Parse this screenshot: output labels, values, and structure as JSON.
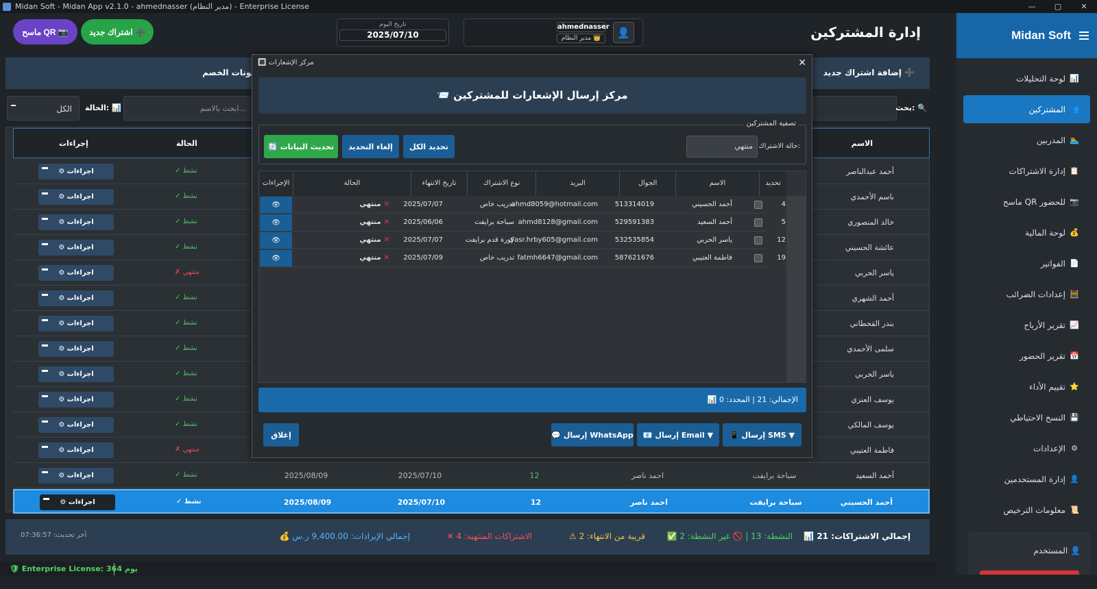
{
  "window": {
    "title": "Midan Soft - Midan App v2.1.0 - ahmednasser (مدير النظام) - Enterprise License",
    "minimize": "—",
    "maximize": "▢",
    "close": "✕"
  },
  "sidebar": {
    "brand": "Midan Soft",
    "items": [
      {
        "label": "لوحة التحليلات",
        "icon": "📊"
      },
      {
        "label": "المشتركين",
        "icon": "👥"
      },
      {
        "label": "المدربين",
        "icon": "🏊"
      },
      {
        "label": "إدارة الاشتراكات",
        "icon": "📋"
      },
      {
        "label": "ماسح QR للحضور",
        "icon": "📷"
      },
      {
        "label": "لوحة المالية",
        "icon": "💰"
      },
      {
        "label": "الفواتير",
        "icon": "📄"
      },
      {
        "label": "إعدادات الضرائب",
        "icon": "🧮"
      },
      {
        "label": "تقرير الأرباح",
        "icon": "📈"
      },
      {
        "label": "تقرير الحضور",
        "icon": "📅"
      },
      {
        "label": "تقييم الأداء",
        "icon": "⭐"
      },
      {
        "label": "النسخ الاحتياطي",
        "icon": "💾"
      },
      {
        "label": "الإعدادات",
        "icon": "⚙"
      },
      {
        "label": "إدارة المستخدمين",
        "icon": "👤"
      },
      {
        "label": "معلومات الترخيص",
        "icon": "📜"
      }
    ],
    "user_label": "المستخدم",
    "user_icon": "👤"
  },
  "header": {
    "title": "إدارة المشتركين",
    "qr_button": "ماسح QR 📷",
    "new_sub_button": "اشتراك جديد ➕",
    "date_label": "تاريخ اليوم",
    "date_value": "2025/07/10",
    "username": "ahmednasser",
    "role": "مدير النظام 👑",
    "avatar_icon": "👤"
  },
  "actionbar": {
    "add_new": "إضافة اشتراك جديد ➕",
    "coupons": "كوبونات الخصم"
  },
  "search": {
    "status_label": "الحالة:",
    "status_icon": "📊",
    "status_value": "الكل",
    "search_placeholder": "ابحث بالاسم...",
    "search_label": "بحث:",
    "search_icon": "🔍"
  },
  "bg_table": {
    "headers": {
      "name": "الاسم",
      "status": "الحالة",
      "actions": "إجراءات"
    },
    "action_label": "⚙ اجراءات",
    "rows": [
      {
        "name": "أحمد عبدالناصر",
        "status": "✓ نشط",
        "ok": true
      },
      {
        "name": "باسم الأحمدي",
        "status": "✓ نشط",
        "ok": true
      },
      {
        "name": "خالد المنصوري",
        "status": "✓ نشط",
        "ok": true
      },
      {
        "name": "عائشة الحسيني",
        "status": "✓ نشط",
        "ok": true
      },
      {
        "name": "ياسر الحربي",
        "status": "✗ منتهي",
        "ok": false
      },
      {
        "name": "أحمد الشهري",
        "status": "✓ نشط",
        "ok": true
      },
      {
        "name": "بندر القحطاني",
        "status": "✓ نشط",
        "ok": true
      },
      {
        "name": "سلمى الأحمدي",
        "status": "✓ نشط",
        "ok": true
      },
      {
        "name": "ياسر الحربي",
        "status": "✓ نشط",
        "ok": true
      },
      {
        "name": "يوسف العنزي",
        "status": "✓ نشط",
        "ok": true
      },
      {
        "name": "يوسف المالكي",
        "status": "✓ نشط",
        "ok": true
      },
      {
        "name": "فاطمة العتيبي",
        "status": "✗ منتهي",
        "ok": false
      },
      {
        "name": "أحمد السعيد",
        "status": "✓ نشط",
        "ok": true,
        "type": "سباحة برايفت",
        "coach": "احمد ناصر",
        "sessions": "12",
        "start": "2025/07/10",
        "end": "2025/08/09"
      },
      {
        "name": "أحمد الحسيني",
        "status": "✓ نشط",
        "ok": true,
        "type": "سباحة برايفت",
        "coach": "احمد ناصر",
        "sessions": "12",
        "start": "2025/07/10",
        "end": "2025/08/09",
        "selected": true
      }
    ]
  },
  "summary": {
    "total": "📊 إجمالي الاشتراكات: 21",
    "active": "✅ النشطة: 13 | 🚫 غير النشطة: 2",
    "near_end": "⚠ قريبة من الانتهاء: 2",
    "expired": "✕ الاشتراكات المنتهية: 4",
    "revenue": "💰 إجمالي الإيرادات: 9,400.00 ر.س",
    "updated": "آخر تحديث: 07:36:57"
  },
  "statusbar": {
    "license": "🛡 Enterprise License: 364 يوم"
  },
  "modal": {
    "title": "مركز الإشعارات",
    "title_icon": "🔳",
    "heading": "📨 مركز إرسال الإشعارات للمشتركين",
    "filter_legend": "تصفية المشتركين",
    "filter_label": "حالة الاشتراك:",
    "filter_value": "منتهي",
    "select_all": "تحديد الكل",
    "clear_selection": "إلغاء التحديد",
    "refresh": "🔄 تحديث البيانات",
    "columns": [
      "تحديد",
      "الاسم",
      "الجوال",
      "البريد",
      "نوع الاشتراك",
      "تاريخ الانتهاء",
      "الحالة",
      "الإجراءات"
    ],
    "rows": [
      {
        "idx": "4",
        "name": "أحمد الحسيني",
        "phone": "513314019",
        "email": "ahmd8059@hotmail.com",
        "type": "تدريب خاص",
        "end": "2025/07/07",
        "status": "منتهي"
      },
      {
        "idx": "5",
        "name": "أحمد السعيد",
        "phone": "529591383",
        "email": "ahmd8128@gmail.com",
        "type": "سباحة برايفت",
        "end": "2025/06/06",
        "status": "منتهي"
      },
      {
        "idx": "12",
        "name": "ياسر الحربي",
        "phone": "532535854",
        "email": "yasr.hrby605@gmail.com",
        "type": "كورة قدم برايفت",
        "end": "2025/07/07",
        "status": "منتهي"
      },
      {
        "idx": "19",
        "name": "فاطمة العتيبي",
        "phone": "587621676",
        "email": "fatmh6647@gmail.com",
        "type": "تدريب خاص",
        "end": "2025/07/09",
        "status": "منتهي"
      }
    ],
    "view_icon": "👁",
    "status_icon": "✕",
    "total": "📊 الإجمالي: 21 | المحدد: 0",
    "close_button": "إغلاق",
    "whatsapp_button": "💬 إرسال WhatsApp",
    "email_button": "📧 إرسال Email ▼",
    "sms_button": "📱 إرسال SMS ▼"
  }
}
